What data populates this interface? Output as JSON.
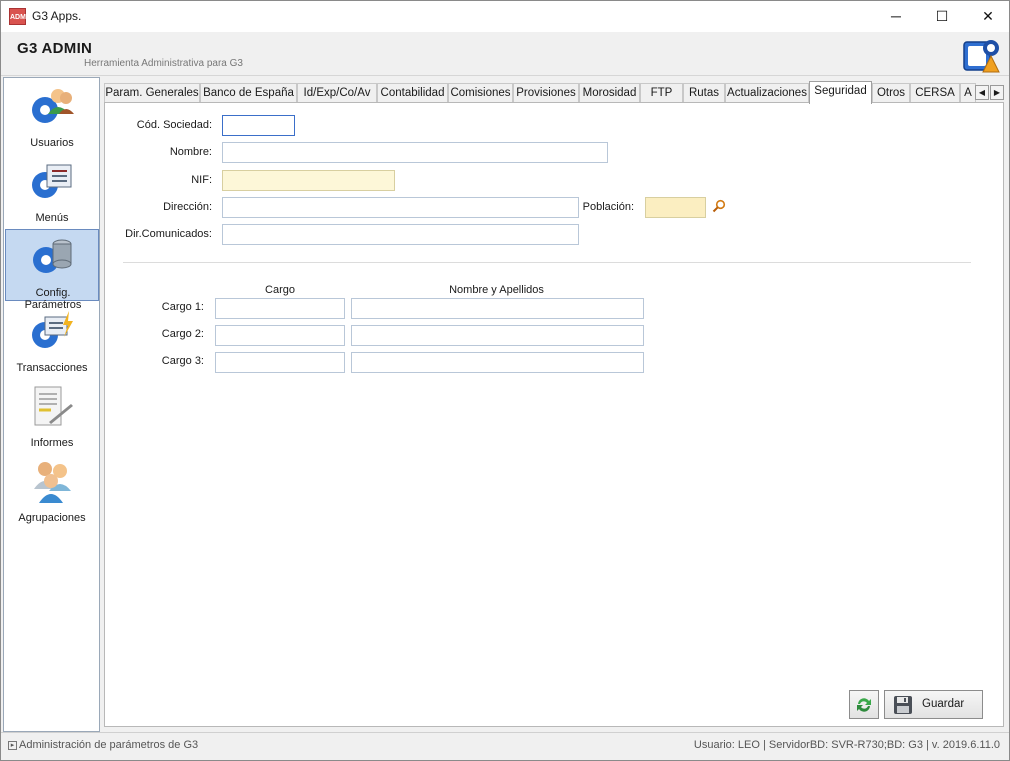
{
  "window": {
    "title": "G3 Apps.",
    "icon_text": "ADM",
    "minimize_glyph": "─",
    "maximize_glyph": "☐",
    "close_glyph": "✕"
  },
  "header": {
    "title": "G3 ADMIN",
    "subtitle": "Herramienta Administrativa para G3"
  },
  "sidebar": {
    "items": [
      {
        "label": "Usuarios",
        "icon": "users-gear-icon"
      },
      {
        "label": "Menús",
        "icon": "menu-gear-icon"
      },
      {
        "label": "Config. Parámetros",
        "icon": "database-gear-icon",
        "active": true
      },
      {
        "label": "Transacciones",
        "icon": "transactions-gear-icon"
      },
      {
        "label": "Informes",
        "icon": "report-document-icon"
      },
      {
        "label": "Agrupaciones",
        "icon": "group-users-icon"
      }
    ]
  },
  "tabs": [
    {
      "label": "Param. Generales"
    },
    {
      "label": "Banco de España"
    },
    {
      "label": "Id/Exp/Co/Av"
    },
    {
      "label": "Contabilidad"
    },
    {
      "label": "Comisiones"
    },
    {
      "label": "Provisiones"
    },
    {
      "label": "Morosidad"
    },
    {
      "label": "FTP"
    },
    {
      "label": "Rutas"
    },
    {
      "label": "Actualizaciones"
    },
    {
      "label": "Seguridad",
      "active": true
    },
    {
      "label": "Otros"
    },
    {
      "label": "CERSA"
    },
    {
      "label": "A"
    }
  ],
  "tab_scroll": {
    "left": "◀",
    "right": "▶"
  },
  "form": {
    "cod_sociedad_label": "Cód. Sociedad:",
    "cod_sociedad_value": "",
    "nombre_label": "Nombre:",
    "nombre_value": "",
    "nif_label": "NIF:",
    "nif_value": "",
    "direccion_label": "Dirección:",
    "direccion_value": "",
    "poblacion_label": "Población:",
    "poblacion_value": "",
    "dir_comunicados_label": "Dir.Comunicados:",
    "dir_comunicados_value": ""
  },
  "cargos": {
    "col_cargo": "Cargo",
    "col_nombre": "Nombre y Apellidos",
    "rows": [
      {
        "label": "Cargo 1:",
        "cargo": "",
        "nombre": ""
      },
      {
        "label": "Cargo 2:",
        "cargo": "",
        "nombre": ""
      },
      {
        "label": "Cargo 3:",
        "cargo": "",
        "nombre": ""
      }
    ]
  },
  "buttons": {
    "save_label": "Guardar"
  },
  "status": {
    "left": "Administración de parámetros de G3",
    "right": "Usuario: LEO  |  ServidorBD: SVR-R730;BD: G3 |  v. 2019.6.11.0"
  },
  "colors": {
    "accent": "#3b6fc9",
    "active_sidebar": "#c5d9f1",
    "poblacion_bg": "#fbeec1"
  }
}
